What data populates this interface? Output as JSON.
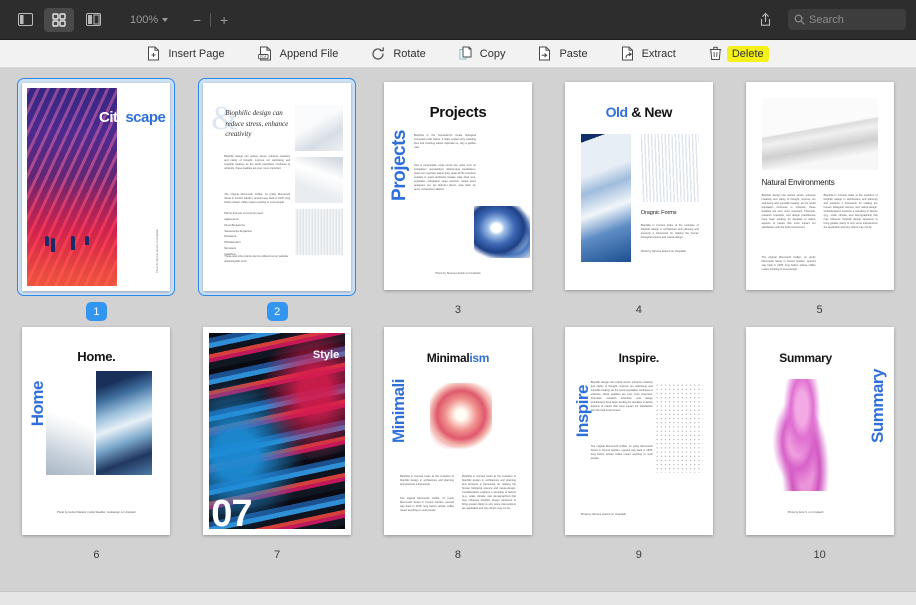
{
  "titlebar": {
    "view_buttons": [
      {
        "name": "sidebar-view",
        "icon": "sidebar-icon",
        "active": false
      },
      {
        "name": "thumbnail-grid-view",
        "icon": "grid-icon",
        "active": true
      },
      {
        "name": "split-view",
        "icon": "split-view-icon",
        "active": false
      }
    ],
    "zoom_level": "100%",
    "zoom_out_label": "−",
    "zoom_in_label": "+",
    "share_icon": "share-icon",
    "search": {
      "placeholder": "Search",
      "value": "",
      "icon": "search-icon"
    }
  },
  "toolbar": {
    "items": [
      {
        "label": "Insert Page",
        "icon": "insert-page-icon",
        "highlighted": false
      },
      {
        "label": "Append File",
        "icon": "append-file-icon",
        "highlighted": false
      },
      {
        "label": "Rotate",
        "icon": "rotate-icon",
        "highlighted": false
      },
      {
        "label": "Copy",
        "icon": "copy-icon",
        "highlighted": false
      },
      {
        "label": "Paste",
        "icon": "paste-icon",
        "highlighted": false
      },
      {
        "label": "Extract",
        "icon": "extract-icon",
        "highlighted": false
      },
      {
        "label": "Delete",
        "icon": "trash-icon",
        "highlighted": true
      }
    ],
    "highlight_color": "#f5f019"
  },
  "colors": {
    "accent_blue": "#2f6fdb",
    "selection_blue": "#2e86e8",
    "selection_fill": "#cfe3f7",
    "badge_blue": "#3296f0",
    "canvas_gray": "#d2d2d2"
  },
  "pages": [
    {
      "number": "1",
      "selected": true,
      "title_parts": [
        "City",
        "scape"
      ],
      "credit": "Photo by\nSimone Hutsch on Unsplash"
    },
    {
      "number": "2",
      "selected": true,
      "ampersand": "&",
      "headline": "Biophilic design can reduce stress, enhance creativity",
      "body": "Biophilic design can reduce stress, enhance creativity and clarity of thought, improve our well-being and expedite healing; as the world population continues to urbanize, these qualities are ever more important.",
      "body2": "The original Monmouth Coffee, on pretty Monmouth Street in Covent Garden, opened way back in 1978, long before artisan coffee meant anything to most people.",
      "list_heading": "Plants that are commonly used:",
      "list_items": [
        "Aglaonema",
        "Ficus Benjamina",
        "Sansevieria Zeylanica",
        "Dracaena",
        "Philodendron",
        "Monstera",
        "Calathea"
      ],
      "footer": "These and other plants can be ordered at our website: www.biophilic.com/"
    },
    {
      "number": "3",
      "selected": false,
      "title": "Projects",
      "vertical": "Projects",
      "body": "Biophilia is the humankind's innate biological connection with nature. It helps explain why crackling fires and crashing waves captivate us, why a garden view.",
      "body2": "Sed ut perspiciatis, unde omnis iste natus error sit voluptatem accusantium doloremque laudantium, totam rem aperiam eaque ipsa, quae ab illo inventore veritatis et quasi architecto beatae vitae dicta sunt, explicabo. voluptatem sequi nesciunt, neque porro quisquam est, qui dolorem ipsum, quia dolor sit, amet, consectetur adipisci.",
      "credit": "Photo by\nSimone Hutsch on Unsplash"
    },
    {
      "number": "4",
      "selected": false,
      "title_parts": [
        "Old",
        " & New"
      ],
      "subtitle": "Oragnic Forms",
      "body": "Biophilia in Context looks at the evolution of biophilic design in architecture and planning and presents a framework for relating the human biological science and nature-design.",
      "credit": "Photo by\nSimone Hutsch\non Unsplash"
    },
    {
      "number": "5",
      "selected": false,
      "title": "Natural Environments",
      "column1": "Biophilic design can reduce stress, enhance creativity and clarity of thought, improve our well-being and expedite healing; as the world population continues to urbanize, these qualities are ever more important. Theorists, research scientists, and design practitioners have been working for decades to define aspects of nature that most impact our satisfaction with the built environment.",
      "column1b": "The original Monmouth Coffee, on pretty Monmouth Street in Covent Garden, opened way back in 1978, long before artisan coffee meant anything to most people.",
      "column2": "Biophilia in Context looks at the evolution of biophilic design in architecture and planning and presents a framework for relating the human biological science and nature-design. Considerations explores a sampling of factors (e.g., scale, climate, user demographics) that may influence biophilic design decisions to bring greater clarity to why some interventions are applicable and why others may not be."
    },
    {
      "number": "6",
      "selected": false,
      "title": "Home.",
      "vertical": "Home",
      "credit": "Photo by Hubert Mariani,\nInside Weather, ruutidesign\non Unsplash"
    },
    {
      "number": "7",
      "selected": false,
      "title": "Style",
      "big_number": "07"
    },
    {
      "number": "8",
      "selected": false,
      "title_parts": [
        "Minimal",
        "ism"
      ],
      "vertical": "Minimali",
      "column1": "Biophilia in Context looks at the evolution of biophilic design in architecture and planning and presents a framework.",
      "column1b": "The original Monmouth Coffee, on pretty Monmouth Street in Covent Garden, opened way back in 1978, long before artisan coffee meant anything to most people.",
      "column2": "Biophilia in Context looks at the evolution of biophilic design in architecture and planning and presents a framework for relating the human biological science and nature-design. Considerations explores a sampling of factors (e.g., scale, climate, user demographics) that may influence biophilic design decisions to bring greater clarity to why some interventions are applicable and why others may not be."
    },
    {
      "number": "9",
      "selected": false,
      "title": "Inspire.",
      "vertical": "Inspire",
      "body": "Biophilic design can reduce stress, enhance creativity and clarity of thought, improve our well-being and expedite healing; as the world population continues to urbanize, these qualities are ever more important. Theorists, research scientists, and design practitioners have been working for decades to define aspects of nature that most impact our satisfaction with the built environment.",
      "body2": "The original Monmouth Coffee, on pretty Monmouth Street in Covent Garden, opened way back in 1978, long before artisan coffee meant anything to most people.",
      "credit": "Photo by\nSimone Hutsch on Unsplash"
    },
    {
      "number": "10",
      "selected": false,
      "title": "Summary",
      "vertical": "Summary",
      "credit": "Photo by Evie S. on Unsplash"
    }
  ]
}
